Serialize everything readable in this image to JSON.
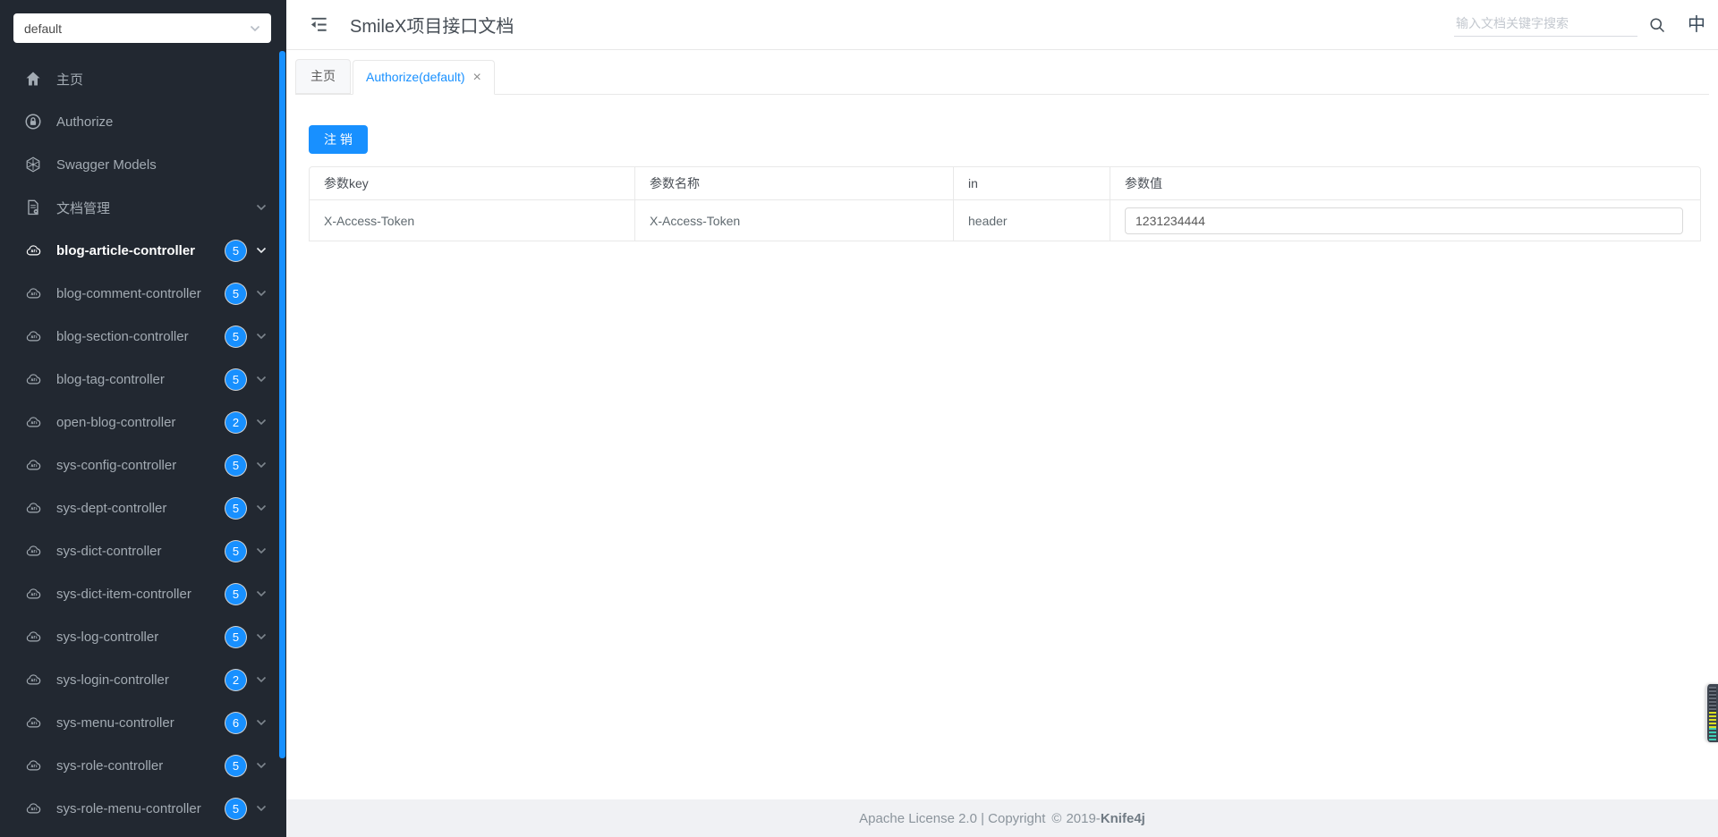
{
  "app": {
    "title": "SmileX项目接口文档"
  },
  "sidebar": {
    "group_select": {
      "value": "default"
    },
    "nav_items": [
      {
        "label": "主页",
        "icon": "home-icon"
      },
      {
        "label": "Authorize",
        "icon": "lock-icon"
      },
      {
        "label": "Swagger Models",
        "icon": "models-icon"
      },
      {
        "label": "文档管理",
        "icon": "doc-manage-icon"
      }
    ],
    "controllers": [
      {
        "label": "blog-article-controller",
        "count": 5,
        "active": true
      },
      {
        "label": "blog-comment-controller",
        "count": 5,
        "active": false
      },
      {
        "label": "blog-section-controller",
        "count": 5,
        "active": false
      },
      {
        "label": "blog-tag-controller",
        "count": 5,
        "active": false
      },
      {
        "label": "open-blog-controller",
        "count": 2,
        "active": false
      },
      {
        "label": "sys-config-controller",
        "count": 5,
        "active": false
      },
      {
        "label": "sys-dept-controller",
        "count": 5,
        "active": false
      },
      {
        "label": "sys-dict-controller",
        "count": 5,
        "active": false
      },
      {
        "label": "sys-dict-item-controller",
        "count": 5,
        "active": false
      },
      {
        "label": "sys-log-controller",
        "count": 5,
        "active": false
      },
      {
        "label": "sys-login-controller",
        "count": 2,
        "active": false
      },
      {
        "label": "sys-menu-controller",
        "count": 6,
        "active": false
      },
      {
        "label": "sys-role-controller",
        "count": 5,
        "active": false
      },
      {
        "label": "sys-role-menu-controller",
        "count": 5,
        "active": false
      }
    ]
  },
  "header": {
    "search_placeholder": "输入文档关键字搜索"
  },
  "tabs": [
    {
      "label": "主页",
      "active": false,
      "closable": false
    },
    {
      "label": "Authorize(default)",
      "active": true,
      "closable": true
    }
  ],
  "authorize": {
    "logout_label": "注 销",
    "table": {
      "columns": [
        "参数key",
        "参数名称",
        "in",
        "参数值"
      ],
      "rows": [
        {
          "key": "X-Access-Token",
          "name": "X-Access-Token",
          "in": "header",
          "value": "1231234444"
        }
      ]
    }
  },
  "footer": {
    "license_text": "Apache License 2.0 | Copyright",
    "year_text": "2019-",
    "brand": "Knife4j"
  },
  "icons": {
    "close_tab": "×",
    "language": "中",
    "copyright": "©"
  },
  "colors": {
    "accent_blue": "#1890ff",
    "sidebar_bg": "#222831",
    "footer_bg": "#f0f1f4",
    "border": "#e8e8e8"
  }
}
